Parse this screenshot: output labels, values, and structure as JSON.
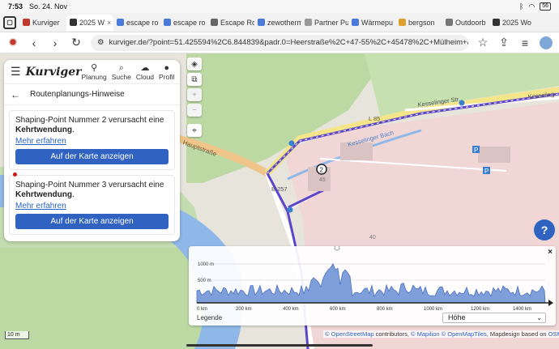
{
  "status": {
    "time": "7:53",
    "date": "So. 24. Nov",
    "battery": "56"
  },
  "tabs": [
    {
      "label": "Kurviger",
      "fav": "#c0392b"
    },
    {
      "label": "2025 W",
      "fav": "#333333",
      "active": true
    },
    {
      "label": "escape ro",
      "fav": "#4a7bd8"
    },
    {
      "label": "escape ro",
      "fav": "#4a7bd8"
    },
    {
      "label": "Escape Ro",
      "fav": "#666666"
    },
    {
      "label": "zewotherm",
      "fav": "#4a7bd8"
    },
    {
      "label": "Partner Pu",
      "fav": "#999999"
    },
    {
      "label": "Wärmepu",
      "fav": "#4a7bd8"
    },
    {
      "label": "bergson",
      "fav": "#e0a030"
    },
    {
      "label": "Outdoorb",
      "fav": "#777777"
    },
    {
      "label": "2025 Wo",
      "fav": "#333333"
    }
  ],
  "toolbar": {
    "url": "kurviger.de/?point=51.425594%2C6.844839&padr.0=Heerstraße%2C+47-55%2C+45478%2C+Mülheim+an+der+Ruhr"
  },
  "panel": {
    "logo": "Kurviger",
    "nav": [
      {
        "label": "Planung",
        "icon": "route-icon"
      },
      {
        "label": "Suche",
        "icon": "search-icon"
      },
      {
        "label": "Cloud",
        "icon": "cloud-icon"
      },
      {
        "label": "Profil",
        "icon": "profile-icon"
      }
    ],
    "title": "Routenplanungs-Hinweise",
    "hints": [
      {
        "text": "Shaping-Point Nummer 2 verursacht eine ",
        "bold": "Kehrtwendung",
        "end": ".",
        "more": "Mehr erfahren",
        "button": "Auf der Karte anzeigen"
      },
      {
        "text": "Shaping-Point Nummer 3 verursacht eine ",
        "bold": "Kehrtwendung",
        "end": ".",
        "more": "Mehr erfahren",
        "button": "Auf der Karte anzeigen"
      }
    ]
  },
  "map": {
    "labels": {
      "l85": "L 85",
      "b257": "B 257",
      "hauptstrasse": "Hauptstraße",
      "kesselinger_bach": "Kesselinger Bach",
      "kesselinger_str": "Kesselinger Str.",
      "kesselinger2": "Kesseling",
      "house_no": "45",
      "house_no2": "40"
    },
    "help": "?",
    "scale": "10 m",
    "colors": {
      "route": "#5b45c9",
      "river": "#8fb8e8",
      "green": "#b9d9a1",
      "pink": "#f1d6d6"
    }
  },
  "elevation": {
    "close": "×",
    "y_ticks": [
      "1000 m",
      "500 m"
    ],
    "x_ticks": [
      "0 km",
      "200 km",
      "400 km",
      "600 km",
      "800 km",
      "1000 km",
      "1200 km",
      "1400 km"
    ],
    "legend": "Legende",
    "select": "Höhe"
  },
  "attribution": {
    "osm": "© OpenStreetMap",
    "contrib": " contributors, ",
    "mapilion": "© Mapilion",
    "omt": " © OpenMapTiles",
    "rest": ", Mapdesign based on ",
    "liberty": "OSM Liberty"
  }
}
